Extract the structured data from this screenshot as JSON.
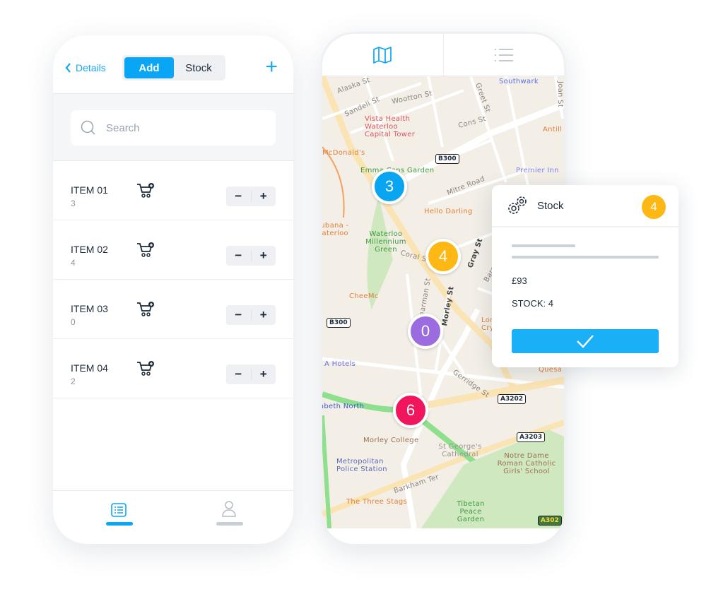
{
  "left_phone": {
    "back_label": "Details",
    "segments": [
      "Add",
      "Stock"
    ],
    "active_segment": "Add",
    "add_icon": "plus-icon",
    "search": {
      "placeholder": "Search",
      "value": ""
    },
    "items": [
      {
        "name": "ITEM 01",
        "count": "3"
      },
      {
        "name": "ITEM 02",
        "count": "4"
      },
      {
        "name": "ITEM 03",
        "count": "0"
      },
      {
        "name": "ITEM 04",
        "count": "2"
      }
    ],
    "stepper": {
      "minus": "−",
      "plus": "+"
    },
    "bottom_nav": [
      {
        "icon": "list-icon",
        "active": true
      },
      {
        "icon": "user-icon",
        "active": false
      }
    ]
  },
  "right_phone": {
    "tabs": [
      {
        "icon": "map-icon",
        "active": true
      },
      {
        "icon": "list-icon",
        "active": false
      }
    ],
    "map_labels": [
      "Alaska St",
      "Sandell St",
      "Wootton St",
      "Greet St",
      "Cons St",
      "Southwark",
      "Joan St",
      "Vista Health Waterloo Capital Tower",
      "McDonald's",
      "Antill",
      "B300",
      "Emma Cons Garden",
      "Premier Inn",
      "Mitre Road",
      "Hello Darling",
      "Cubana - Waterloo",
      "Waterloo Millennium Green",
      "Coral St",
      "Gray St",
      "Baron's",
      "Pearman St",
      "Morley St",
      "CheeMc",
      "London Crys",
      "A Hotels",
      "Quesa",
      "Gerridge St",
      "Lambeth North",
      "A3202",
      "Morley College",
      "A3203",
      "St George's Cathedral",
      "Metropolitan Police Station",
      "Notre Dame Roman Catholic Girls' School",
      "Barkham Ter",
      "The Three Stags",
      "Tibetan Peace Garden",
      "A302"
    ],
    "markers": [
      {
        "value": "3",
        "color": "#0aa5f0"
      },
      {
        "value": "4",
        "color": "#fdb813"
      },
      {
        "value": "0",
        "color": "#9b6be0"
      },
      {
        "value": "6",
        "color": "#f0155c"
      }
    ]
  },
  "card": {
    "icon": "gears-icon",
    "title": "Stock",
    "badge": "4",
    "badge_color": "#fdb813",
    "price": "£93",
    "stock": "STOCK: 4",
    "confirm_icon": "check-icon"
  },
  "colors": {
    "accent": "#08a6f5",
    "text": "#1d2b3a"
  }
}
